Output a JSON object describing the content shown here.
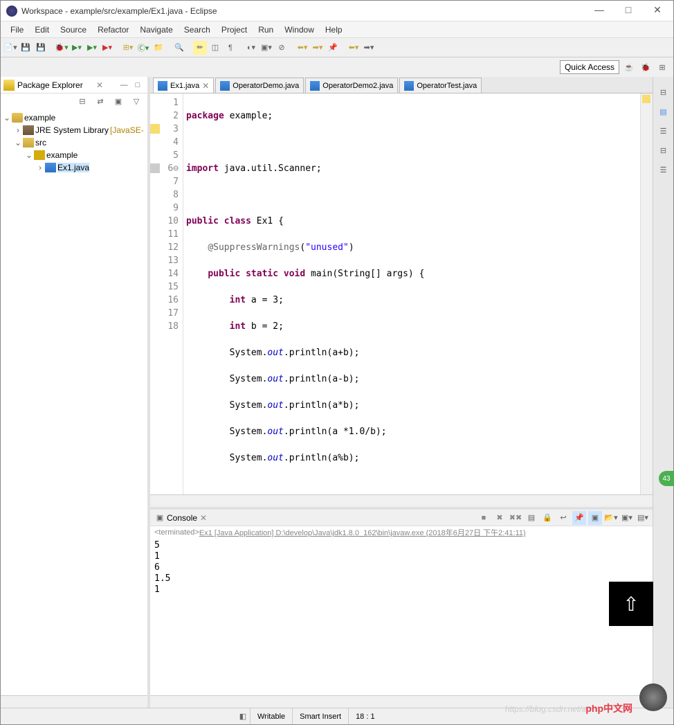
{
  "window": {
    "title": "Workspace - example/src/example/Ex1.java - Eclipse"
  },
  "menu": [
    "File",
    "Edit",
    "Source",
    "Refactor",
    "Navigate",
    "Search",
    "Project",
    "Run",
    "Window",
    "Help"
  ],
  "quick_access": "Quick Access",
  "sidebar": {
    "title": "Package Explorer",
    "tree": {
      "proj": "example",
      "jre": "JRE System Library",
      "jre_tag": "[JavaSE-",
      "src": "src",
      "pkg": "example",
      "file": "Ex1.java"
    }
  },
  "tabs": [
    {
      "label": "Ex1.java",
      "active": true,
      "close": true
    },
    {
      "label": "OperatorDemo.java",
      "active": false
    },
    {
      "label": "OperatorDemo2.java",
      "active": false
    },
    {
      "label": "OperatorTest.java",
      "active": false
    }
  ],
  "code": {
    "lines": [
      "1",
      "2",
      "3",
      "4",
      "5",
      "6",
      "7",
      "8",
      "9",
      "10",
      "11",
      "12",
      "13",
      "14",
      "15",
      "16",
      "17",
      "18"
    ]
  },
  "console": {
    "title": "Console",
    "info_prefix": "<terminated> ",
    "info_main": "Ex1 [Java Application] D:\\develop\\Java\\jdk1.8.0_162\\bin\\javaw.exe (2018年6月27日 下午2:41:11)",
    "out": [
      "5",
      "1",
      "6",
      "1.5",
      "1"
    ]
  },
  "status": {
    "writable": "Writable",
    "insert": "Smart Insert",
    "pos": "18 : 1"
  },
  "watermark": "https://blog.csdn.net/an",
  "php": "php中文网",
  "badge": "43"
}
